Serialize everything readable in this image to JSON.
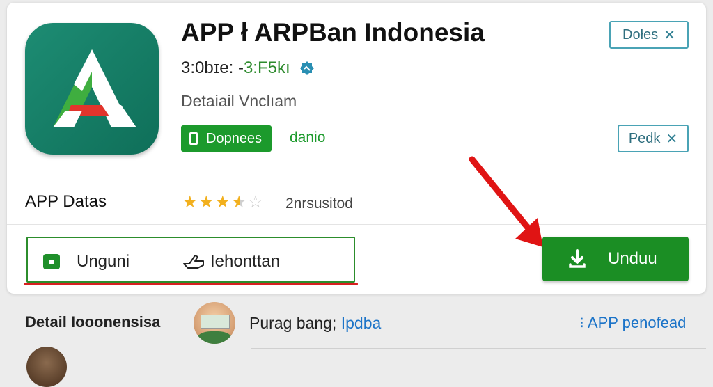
{
  "app": {
    "title": "APP ł ARPBan Indonesia",
    "version_prefix": "3:0bɪe: - ",
    "version_highlight": "3:F5kı",
    "subtitle": "Detaiail Vnclıam",
    "badge_label": "Dopnees",
    "badge_side": "danio",
    "icon_colors": {
      "bg": "#1d8c73",
      "letter": "#ffffff",
      "accent_green": "#3fae3f",
      "accent_red": "#e2342c"
    }
  },
  "buttons": {
    "top_label": "Dołes",
    "mid_label": "Pedk",
    "x_glyph": "✕"
  },
  "rating": {
    "label": "APP Datas",
    "value": 3.5,
    "max": 5,
    "review_text": "2nrsusitod"
  },
  "actions": {
    "item1": "Unguni",
    "item2": "Iehonttan"
  },
  "download": {
    "label": "Unduu",
    "color": "#1b8e24"
  },
  "annotation": {
    "arrow_color": "#e01414"
  },
  "bottom": {
    "title": "Detail Iooonensisa",
    "text": "Purag bang; ",
    "link": "Ipdba",
    "right_link": "⁝ APP penofead"
  }
}
